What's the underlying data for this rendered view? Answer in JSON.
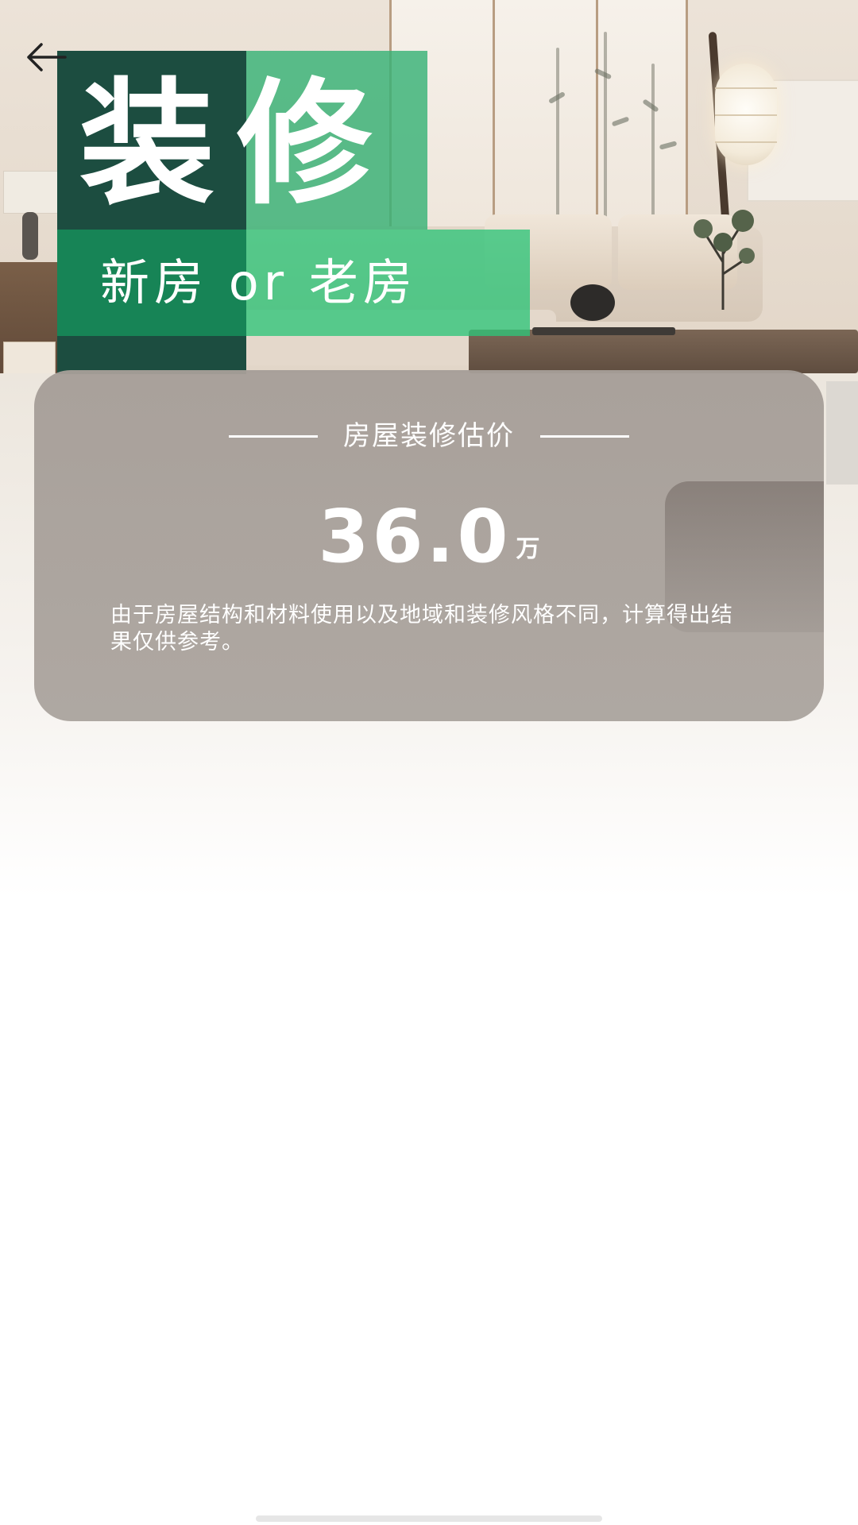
{
  "header": {
    "back_icon": "arrow-left-icon",
    "title_chars": [
      "装",
      "修"
    ],
    "subtitle": "新房 or 老房"
  },
  "estimate": {
    "heading": "房屋装修估价",
    "value": "36.0",
    "unit": "万",
    "note": "由于房屋结构和材料使用以及地域和装修风格不同，计算得出结果仅供参考。"
  },
  "colors": {
    "dark_green": "#1c4d40",
    "green": "#178456",
    "light_green": "#2ec478",
    "card_gray": "#a69e98"
  }
}
